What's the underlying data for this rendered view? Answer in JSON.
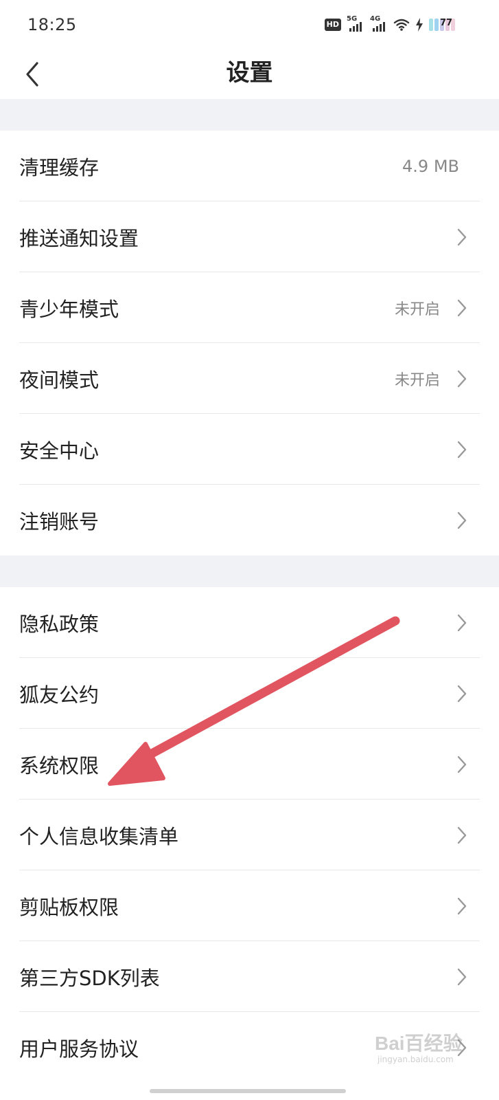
{
  "status_bar": {
    "time": "18:25",
    "network_badge": "HD",
    "signal1_label": "5G",
    "signal2_label": "4G",
    "battery_level": "77"
  },
  "header": {
    "title": "设置",
    "back_icon": "chevron-left-icon"
  },
  "groups": [
    {
      "items": [
        {
          "label": "清理缓存",
          "value": "4.9 MB",
          "chevron": false
        },
        {
          "label": "推送通知设置",
          "value": "",
          "chevron": true
        },
        {
          "label": "青少年模式",
          "value": "未开启",
          "chevron": true
        },
        {
          "label": "夜间模式",
          "value": "未开启",
          "chevron": true
        },
        {
          "label": "安全中心",
          "value": "",
          "chevron": true
        },
        {
          "label": "注销账号",
          "value": "",
          "chevron": true
        }
      ]
    },
    {
      "items": [
        {
          "label": "隐私政策",
          "chevron": true
        },
        {
          "label": "狐友公约",
          "chevron": true
        },
        {
          "label": "系统权限",
          "chevron": true
        },
        {
          "label": "个人信息收集清单",
          "chevron": true
        },
        {
          "label": "剪贴板权限",
          "chevron": true
        },
        {
          "label": "第三方SDK列表",
          "chevron": true
        },
        {
          "label": "用户服务协议",
          "chevron": true
        }
      ]
    }
  ],
  "annotation": {
    "color": "#e05560",
    "points_to": "系统权限"
  },
  "watermark": {
    "text": "Bai百经验",
    "sub": "jingyan.baidu.com"
  },
  "colors": {
    "section_gap": "#f1f2f6",
    "chevron": "#999999",
    "secondary_text": "#888888"
  }
}
